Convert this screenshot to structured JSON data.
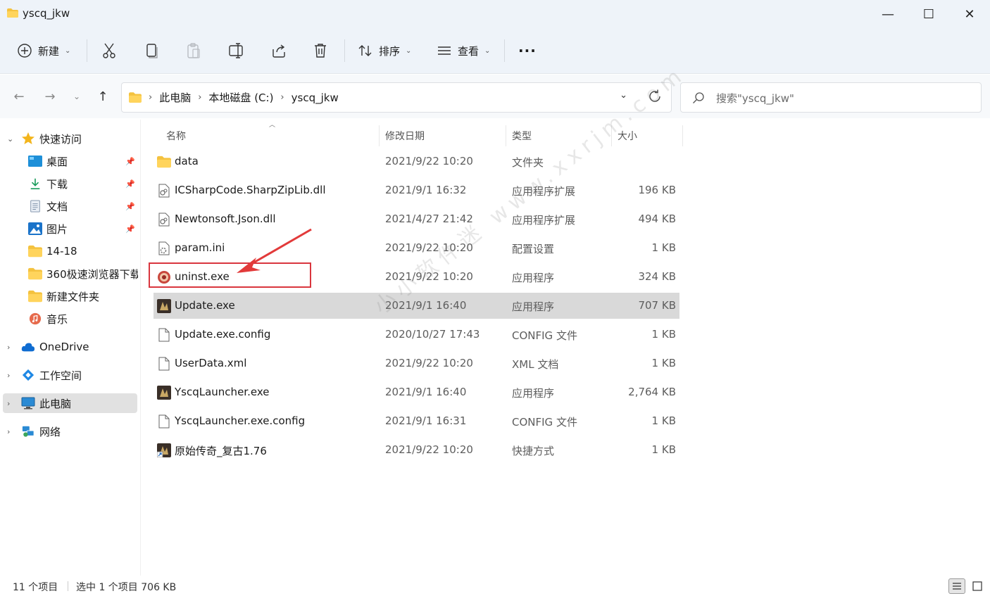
{
  "window": {
    "title": "yscq_jkw",
    "minimize": "—",
    "maximize": "☐",
    "close": "✕"
  },
  "toolbar": {
    "new_label": "新建",
    "sort_label": "排序",
    "view_label": "查看",
    "more_label": "···"
  },
  "nav": {
    "breadcrumb": [
      "此电脑",
      "本地磁盘 (C:)",
      "yscq_jkw"
    ],
    "search_placeholder": "搜索\"yscq_jkw\""
  },
  "sidebar": {
    "quick_access": "快速访问",
    "items": [
      {
        "label": "桌面",
        "icon": "desktop-icon",
        "pinned": true
      },
      {
        "label": "下载",
        "icon": "download-icon",
        "pinned": true
      },
      {
        "label": "文档",
        "icon": "document-icon",
        "pinned": true
      },
      {
        "label": "图片",
        "icon": "picture-icon",
        "pinned": true
      },
      {
        "label": "14-18",
        "icon": "folder-icon",
        "pinned": false
      },
      {
        "label": "360极速浏览器下载",
        "icon": "folder-icon",
        "pinned": false
      },
      {
        "label": "新建文件夹",
        "icon": "folder-icon",
        "pinned": false
      },
      {
        "label": "音乐",
        "icon": "music-icon",
        "pinned": false
      }
    ],
    "onedrive": "OneDrive",
    "workspace": "工作空间",
    "this_pc": "此电脑",
    "network": "网络"
  },
  "columns": {
    "name": "名称",
    "date": "修改日期",
    "type": "类型",
    "size": "大小"
  },
  "files": [
    {
      "name": "data",
      "date": "2021/9/22 10:20",
      "type": "文件夹",
      "size": "",
      "icon": "folder-icon"
    },
    {
      "name": "ICSharpCode.SharpZipLib.dll",
      "date": "2021/9/1 16:32",
      "type": "应用程序扩展",
      "size": "196 KB",
      "icon": "dll-file-icon"
    },
    {
      "name": "Newtonsoft.Json.dll",
      "date": "2021/4/27 21:42",
      "type": "应用程序扩展",
      "size": "494 KB",
      "icon": "dll-file-icon"
    },
    {
      "name": "param.ini",
      "date": "2021/9/22 10:20",
      "type": "配置设置",
      "size": "1 KB",
      "icon": "ini-file-icon"
    },
    {
      "name": "uninst.exe",
      "date": "2021/9/22 10:20",
      "type": "应用程序",
      "size": "324 KB",
      "icon": "uninstaller-icon"
    },
    {
      "name": "Update.exe",
      "date": "2021/9/1 16:40",
      "type": "应用程序",
      "size": "707 KB",
      "icon": "game-exe-icon"
    },
    {
      "name": "Update.exe.config",
      "date": "2020/10/27 17:43",
      "type": "CONFIG 文件",
      "size": "1 KB",
      "icon": "blank-file-icon"
    },
    {
      "name": "UserData.xml",
      "date": "2021/9/22 10:20",
      "type": "XML 文档",
      "size": "1 KB",
      "icon": "blank-file-icon"
    },
    {
      "name": "YscqLauncher.exe",
      "date": "2021/9/1 16:40",
      "type": "应用程序",
      "size": "2,764 KB",
      "icon": "game-exe-icon"
    },
    {
      "name": "YscqLauncher.exe.config",
      "date": "2021/9/1 16:31",
      "type": "CONFIG 文件",
      "size": "1 KB",
      "icon": "blank-file-icon"
    },
    {
      "name": "原始传奇_复古1.76",
      "date": "2021/9/22 10:20",
      "type": "快捷方式",
      "size": "1 KB",
      "icon": "shortcut-icon"
    }
  ],
  "status": {
    "count": "11 个项目",
    "selection": "选中 1 个项目  706 KB"
  },
  "watermark": "小小软件迷 www.xxrjm.com",
  "colors": {
    "chrome_bg": "#eef3f9",
    "selected_row": "#d9d9d9",
    "highlight": "#d9363e",
    "folder": "#f4c23f"
  }
}
